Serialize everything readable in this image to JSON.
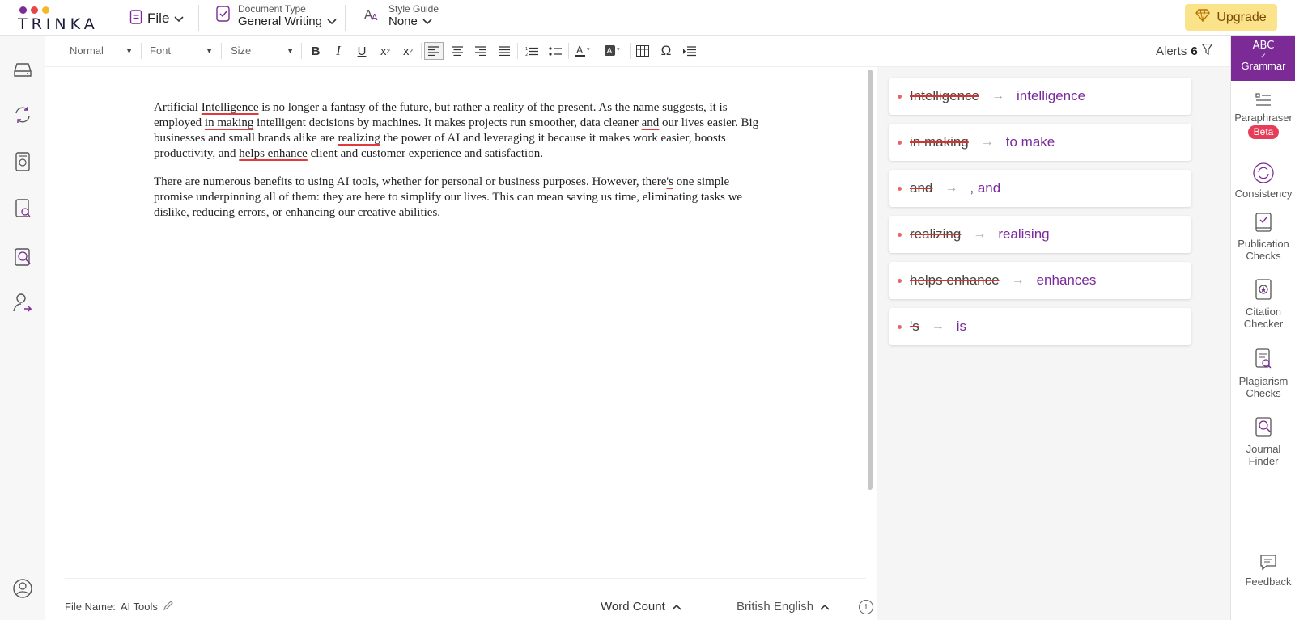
{
  "header": {
    "logo_text": "TRINKA",
    "logo_dot_colors": [
      "#7b2a96",
      "#e8464a",
      "#f5b828"
    ],
    "file_label": "File",
    "document_type_label": "Document Type",
    "document_type_value": "General Writing",
    "style_guide_label": "Style Guide",
    "style_guide_value": "None",
    "upgrade_label": "Upgrade"
  },
  "toolbar": {
    "paragraph_style": "Normal",
    "font": "Font",
    "size": "Size",
    "alerts_label": "Alerts",
    "alerts_count": "6"
  },
  "editor": {
    "paragraphs": [
      [
        {
          "t": "Artificial "
        },
        {
          "t": "Intelligence",
          "err": true
        },
        {
          "t": " is no longer a fantasy of the future, but rather a reality of the present. As the name suggests, it is employed "
        },
        {
          "t": "in making",
          "err": true
        },
        {
          "t": " intelligent decisions by machines. It makes projects run smoother, data cleaner "
        },
        {
          "t": "and",
          "err": true
        },
        {
          "t": " our lives easier. Big businesses and small brands alike are "
        },
        {
          "t": "realizing",
          "err": true
        },
        {
          "t": " the power of AI and leveraging it because it makes work easier, boosts productivity, and "
        },
        {
          "t": "helps enhance",
          "err": true
        },
        {
          "t": " client and customer experience and satisfaction."
        }
      ],
      [
        {
          "t": "There are numerous benefits to using AI tools, whether for personal or business purposes. However, there"
        },
        {
          "t": "'s",
          "err": true
        },
        {
          "t": " one simple promise underpinning all of them: they are here to simplify our lives. This can mean saving us time, eliminating tasks we dislike, reducing errors, or enhancing our creative abilities."
        }
      ]
    ],
    "file_name_label": "File Name:",
    "file_name": "AI Tools",
    "word_count_label": "Word Count",
    "language": "British English"
  },
  "suggestions": [
    {
      "original": "Intelligence",
      "suggestion": "intelligence"
    },
    {
      "original": "in making",
      "suggestion": "to make"
    },
    {
      "original": "and",
      "suggestion": ", and"
    },
    {
      "original": "realizing",
      "suggestion": "realising"
    },
    {
      "original": "helps enhance",
      "suggestion": "enhances"
    },
    {
      "original": "'s",
      "suggestion": "is"
    }
  ],
  "right_tools": {
    "grammar_icon_text": "ABC",
    "grammar": "Grammar",
    "paraphraser": "Paraphraser",
    "beta": "Beta",
    "consistency": "Consistency",
    "publication_1": "Publication",
    "publication_2": "Checks",
    "citation_1": "Citation",
    "citation_2": "Checker",
    "plagiarism_1": "Plagiarism",
    "plagiarism_2": "Checks",
    "journal_1": "Journal",
    "journal_2": "Finder",
    "feedback": "Feedback"
  },
  "colors": {
    "brand_purple": "#7b2a96",
    "error_red": "#e0393e",
    "upgrade_bg": "#fbe38c"
  }
}
